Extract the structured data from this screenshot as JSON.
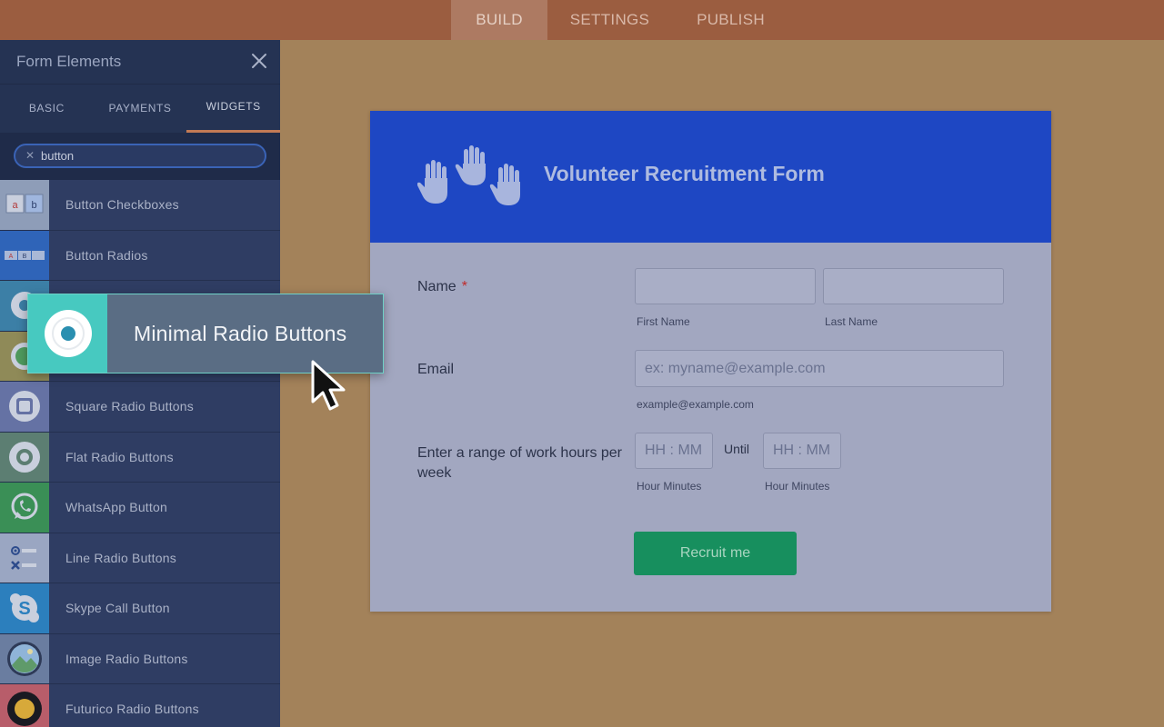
{
  "topnav": {
    "tabs": [
      {
        "label": "BUILD",
        "active": true
      },
      {
        "label": "SETTINGS",
        "active": false
      },
      {
        "label": "PUBLISH",
        "active": false
      }
    ]
  },
  "sidebar": {
    "title": "Form Elements",
    "tabs": [
      {
        "label": "BASIC"
      },
      {
        "label": "PAYMENTS"
      },
      {
        "label": "WIDGETS",
        "active": true
      }
    ],
    "search": {
      "value": "button"
    },
    "items": [
      {
        "label": "Button Checkboxes",
        "icon": "button-checkboxes-icon"
      },
      {
        "label": "Button Radios",
        "icon": "button-radios-icon"
      },
      {
        "label": "",
        "icon": "minimal-radio-icon"
      },
      {
        "label": "",
        "icon": "green-radio-icon"
      },
      {
        "label": "Square Radio Buttons",
        "icon": "square-radio-icon"
      },
      {
        "label": "Flat Radio Buttons",
        "icon": "flat-radio-icon"
      },
      {
        "label": "WhatsApp Button",
        "icon": "whatsapp-icon"
      },
      {
        "label": "Line Radio Buttons",
        "icon": "line-radio-icon"
      },
      {
        "label": "Skype Call Button",
        "icon": "skype-icon"
      },
      {
        "label": "Image Radio Buttons",
        "icon": "image-radio-icon"
      },
      {
        "label": "Futurico Radio Buttons",
        "icon": "futurico-radio-icon"
      }
    ]
  },
  "drag": {
    "label": "Minimal Radio Buttons"
  },
  "form": {
    "title": "Volunteer Recruitment Form",
    "name_label": "Name",
    "required_mark": "*",
    "first_name_sub": "First Name",
    "last_name_sub": "Last Name",
    "email_label": "Email",
    "email_placeholder": "ex: myname@example.com",
    "email_sub": "example@example.com",
    "hours_label": "Enter a range of work hours per week",
    "time_placeholder": "HH : MM",
    "until": "Until",
    "time_sub": "Hour Minutes",
    "submit": "Recruit me"
  },
  "colors": {
    "header_blue": "#1e47c3",
    "submit_green": "#178f5e",
    "accent_teal": "#47c9c0"
  }
}
